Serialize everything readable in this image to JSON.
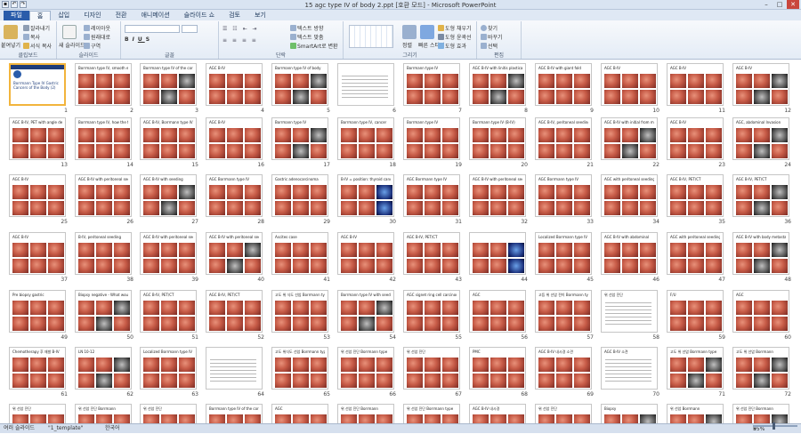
{
  "window": {
    "title": "15 agc type IV of body 2.ppt [호환 모드] - Microsoft PowerPoint"
  },
  "tabs": [
    "파일",
    "홈",
    "삽입",
    "디자인",
    "전환",
    "애니메이션",
    "슬라이드 쇼",
    "검토",
    "보기"
  ],
  "active_tab": "홈",
  "ribbon": {
    "clipboard": {
      "paste": "붙여넣기",
      "cut": "잘라내기",
      "copy": "복사",
      "format_painter": "서식 복사",
      "label": "클립보드"
    },
    "slides": {
      "new_slide": "새 슬라이드",
      "layout": "레이아웃",
      "reset": "원래대로",
      "section": "구역",
      "label": "슬라이드"
    },
    "font": {
      "label": "글꼴"
    },
    "paragraph": {
      "text_direction": "텍스트 방향",
      "align_text": "텍스트 맞춤",
      "smartart": "SmartArt로 변환",
      "label": "단락"
    },
    "drawing": {
      "arrange": "정렬",
      "quick_styles": "빠른 스타일",
      "shape_fill": "도형 채우기",
      "shape_outline": "도형 윤곽선",
      "shape_effects": "도형 효과",
      "label": "그리기"
    },
    "editing": {
      "find": "찾기",
      "replace": "바꾸기",
      "select": "선택",
      "label": "편집"
    }
  },
  "slides": [
    {
      "n": 1,
      "title": "Borrmann Type IV Gastric Cancers of the Body (2)",
      "kind": "title"
    },
    {
      "n": 2,
      "title": "Borrmann type IV, smooth elevation",
      "kind": "endo"
    },
    {
      "n": 3,
      "title": "Borrmann type IV of the corpus/fundus",
      "kind": "endo-ct"
    },
    {
      "n": 4,
      "title": "AGC B-IV",
      "kind": "endo"
    },
    {
      "n": 5,
      "title": "Borrmann type IV of body",
      "kind": "endo-ct"
    },
    {
      "n": 6,
      "title": "",
      "kind": "text"
    },
    {
      "n": 7,
      "title": "Borrmann type IV",
      "kind": "endo"
    },
    {
      "n": 8,
      "title": "AGC B-IV with linitis plastica",
      "kind": "endo-ct"
    },
    {
      "n": 9,
      "title": "AGC B-IV with giant fold",
      "kind": "endo"
    },
    {
      "n": 10,
      "title": "AGC B-IV",
      "kind": "endo"
    },
    {
      "n": 11,
      "title": "AGC B-IV",
      "kind": "endo"
    },
    {
      "n": 12,
      "title": "AGC B-IV",
      "kind": "endo-ct"
    },
    {
      "n": 13,
      "title": "AGC B-IV, PET with angle deformity",
      "kind": "endo"
    },
    {
      "n": 14,
      "title": "Borrmann type IV, how the fold?",
      "kind": "endo"
    },
    {
      "n": 15,
      "title": "AGC B-IV, Borrmann type IV",
      "kind": "endo"
    },
    {
      "n": 16,
      "title": "AGC B-IV",
      "kind": "endo"
    },
    {
      "n": 17,
      "title": "Borrmann type IV",
      "kind": "endo-ct"
    },
    {
      "n": 18,
      "title": "Borrmann type IV, cancer",
      "kind": "endo"
    },
    {
      "n": 19,
      "title": "Borrmann type IV",
      "kind": "endo"
    },
    {
      "n": 20,
      "title": "Borrmann type IV (B-IV)",
      "kind": "endo"
    },
    {
      "n": 21,
      "title": "AGC B-IV, peritoneal seeding",
      "kind": "endo"
    },
    {
      "n": 22,
      "title": "AGC B-IV with initial from metastasis",
      "kind": "endo-ct"
    },
    {
      "n": 23,
      "title": "AGC B-IV",
      "kind": "endo"
    },
    {
      "n": 24,
      "title": "AGC, abdominal Invasion",
      "kind": "endo-ct"
    },
    {
      "n": 25,
      "title": "AGC B-IV",
      "kind": "endo"
    },
    {
      "n": 26,
      "title": "AGC B-IV with peritoneal seeding",
      "kind": "endo"
    },
    {
      "n": 27,
      "title": "AGC B-IV with seeding",
      "kind": "endo-ct"
    },
    {
      "n": 28,
      "title": "AGC Borrmann type IV",
      "kind": "endo"
    },
    {
      "n": 29,
      "title": "Gastric adenocarcinoma",
      "kind": "endo"
    },
    {
      "n": 30,
      "title": "B-IV = position: thyroid cancer",
      "kind": "endo-blue"
    },
    {
      "n": 31,
      "title": "AGC Borrmann type IV",
      "kind": "endo"
    },
    {
      "n": 32,
      "title": "AGC B-IV with peritoneal seeding",
      "kind": "endo"
    },
    {
      "n": 33,
      "title": "AGC Borrmann type IV",
      "kind": "endo"
    },
    {
      "n": 34,
      "title": "AGC with peritoneal seeding",
      "kind": "endo"
    },
    {
      "n": 35,
      "title": "AGC B-IV, PET/CT",
      "kind": "endo"
    },
    {
      "n": 36,
      "title": "AGC B-IV, PET/CT",
      "kind": "endo-ct"
    },
    {
      "n": 37,
      "title": "AGC B-IV",
      "kind": "endo"
    },
    {
      "n": 38,
      "title": "B-IV, peritoneal seeding",
      "kind": "endo"
    },
    {
      "n": 39,
      "title": "AGC B-IV with peritoneal seeding",
      "kind": "endo"
    },
    {
      "n": 40,
      "title": "AGC B-IV with peritoneal seeding",
      "kind": "endo-ct"
    },
    {
      "n": 41,
      "title": "Ascites case",
      "kind": "endo"
    },
    {
      "n": 42,
      "title": "AGC B-IV",
      "kind": "endo"
    },
    {
      "n": 43,
      "title": "AGC B-IV, PET/CT",
      "kind": "endo"
    },
    {
      "n": 44,
      "title": "",
      "kind": "endo-blue"
    },
    {
      "n": 45,
      "title": "Localized Borrmann type IV",
      "kind": "endo"
    },
    {
      "n": 46,
      "title": "AGC B-IV with abdominal",
      "kind": "endo"
    },
    {
      "n": 47,
      "title": "AGC with peritoneal seeding",
      "kind": "endo"
    },
    {
      "n": 48,
      "title": "AGC B-IV with body metastasis",
      "kind": "endo-ct"
    },
    {
      "n": 49,
      "title": "Pre biopsy gastric",
      "kind": "endo"
    },
    {
      "n": 50,
      "title": "Biopsy negative - What would you do?",
      "kind": "endo-ct"
    },
    {
      "n": 51,
      "title": "AGC B-IV, PET/CT",
      "kind": "endo"
    },
    {
      "n": 52,
      "title": "AGC B-IV, PET/CT",
      "kind": "endo"
    },
    {
      "n": 53,
      "title": "고도 위 식도 선암 Borrmann type",
      "kind": "endo"
    },
    {
      "n": 54,
      "title": "Borrmann type IV with seeding",
      "kind": "endo-ct"
    },
    {
      "n": 55,
      "title": "AGC signet ring cell carcinoma",
      "kind": "endo"
    },
    {
      "n": 56,
      "title": "AGC",
      "kind": "endo"
    },
    {
      "n": 57,
      "title": "고등 위 선암 전이 Borrmann type",
      "kind": "endo"
    },
    {
      "n": 58,
      "title": "위 선암 진단",
      "kind": "text"
    },
    {
      "n": 59,
      "title": "F/U",
      "kind": "endo"
    },
    {
      "n": 60,
      "title": "AGC",
      "kind": "endo"
    },
    {
      "n": 61,
      "title": "Chemotherapy 후 재발 B-IV",
      "kind": "endo"
    },
    {
      "n": 62,
      "title": "LN 10-12",
      "kind": "endo-ct"
    },
    {
      "n": 63,
      "title": "Localized Borrmann type IV",
      "kind": "endo"
    },
    {
      "n": 64,
      "title": "",
      "kind": "text"
    },
    {
      "n": 65,
      "title": "고도 위식도 선암 Borrmann type",
      "kind": "endo"
    },
    {
      "n": 66,
      "title": "위 선암 진단 Borrmann type",
      "kind": "endo"
    },
    {
      "n": 67,
      "title": "위 선암 진단",
      "kind": "endo"
    },
    {
      "n": 68,
      "title": "PMC",
      "kind": "endo"
    },
    {
      "n": 69,
      "title": "AGC B-IV 내시경 소견",
      "kind": "endo"
    },
    {
      "n": 70,
      "title": "AGC B-IV 소견",
      "kind": "text"
    },
    {
      "n": 71,
      "title": "고도 위 선암 Borrmann type",
      "kind": "endo-ct"
    },
    {
      "n": 72,
      "title": "고도 위 선암 Borrmann",
      "kind": "endo-ct"
    },
    {
      "n": 73,
      "title": "위 선암 진단",
      "kind": "endo"
    },
    {
      "n": 74,
      "title": "위 선암 진단 Borrmann",
      "kind": "endo"
    },
    {
      "n": 75,
      "title": "위 선암 진단",
      "kind": "endo"
    },
    {
      "n": 76,
      "title": "Borrmann type IV of the corpus",
      "kind": "endo"
    },
    {
      "n": 77,
      "title": "AGC",
      "kind": "endo"
    },
    {
      "n": 78,
      "title": "위 선암 진단 Borrmann",
      "kind": "endo"
    },
    {
      "n": 79,
      "title": "위 선암 진단 Borrmann type",
      "kind": "endo"
    },
    {
      "n": 80,
      "title": "AGC B-IV 내시경",
      "kind": "endo"
    },
    {
      "n": 81,
      "title": "위 선암 진단",
      "kind": "endo"
    },
    {
      "n": 82,
      "title": "Biopsy",
      "kind": "endo-ct"
    },
    {
      "n": 83,
      "title": "위 선암 Borrmann",
      "kind": "endo-ct"
    },
    {
      "n": 84,
      "title": "위 선암 진단 Borrmann",
      "kind": "endo-ct"
    }
  ],
  "status": {
    "view": "여러 슬라이드",
    "theme": "\"1_template\"",
    "language": "한국어",
    "zoom": "55%"
  },
  "colors": {
    "accent": "#2a5caa",
    "selection": "#f2b43c",
    "ribbon_bg": "#e4ecf6"
  }
}
